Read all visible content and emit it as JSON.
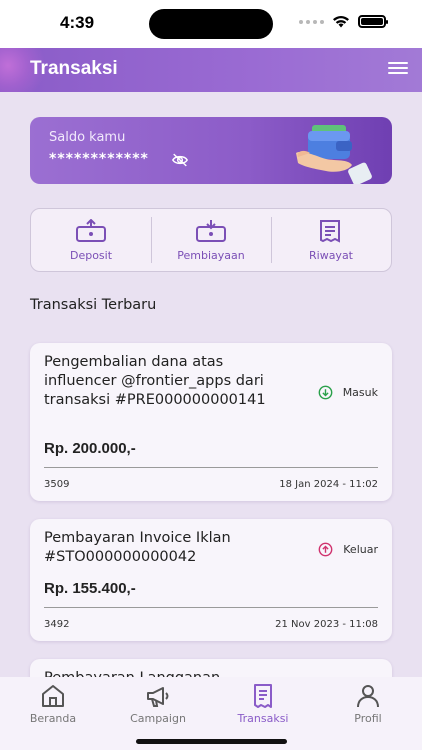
{
  "status_bar": {
    "time": "4:39"
  },
  "header": {
    "title": "Transaksi",
    "menu_icon": "hamburger-menu-icon"
  },
  "balance": {
    "label": "Saldo kamu",
    "masked_value": "************",
    "visibility_icon": "eye-off-icon"
  },
  "actions": [
    {
      "label": "Deposit",
      "icon": "wallet-upload-icon"
    },
    {
      "label": "Pembiayaan",
      "icon": "wallet-download-icon"
    },
    {
      "label": "Riwayat",
      "icon": "receipt-history-icon"
    }
  ],
  "section": {
    "title": "Transaksi Terbaru"
  },
  "transactions": [
    {
      "description": "Pengembalian dana atas influencer @frontier_apps dari transaksi #PRE000000000141",
      "status": "Masuk",
      "status_color": "#2aa04a",
      "amount": "Rp. 200.000,-",
      "id": "3509",
      "date": "18 Jan 2024 - 11:02"
    },
    {
      "description": "Pembayaran Invoice Iklan #STO000000000042",
      "status": "Keluar",
      "status_color": "#d0336e",
      "amount": "Rp. 155.400,-",
      "id": "3492",
      "date": "21 Nov 2023 - 11:08"
    },
    {
      "description": "Pembayaran Langganan"
    }
  ],
  "bottom_nav": [
    {
      "label": "Beranda",
      "icon": "home-icon",
      "active": false
    },
    {
      "label": "Campaign",
      "icon": "megaphone-icon",
      "active": false
    },
    {
      "label": "Transaksi",
      "icon": "receipt-icon",
      "active": true
    },
    {
      "label": "Profil",
      "icon": "user-icon",
      "active": false
    }
  ],
  "colors": {
    "primary": "#8a5cc8",
    "background": "#e9e1f1"
  }
}
